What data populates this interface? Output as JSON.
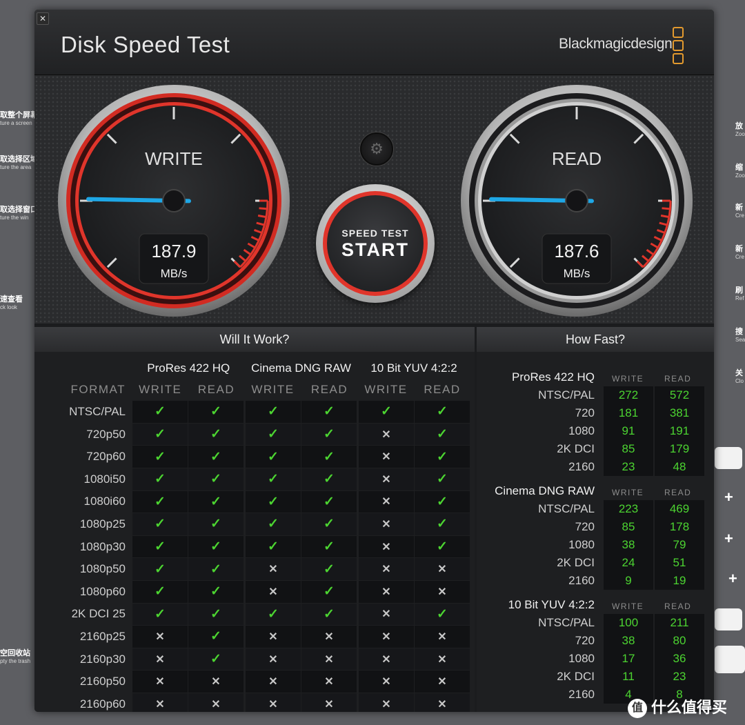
{
  "background": {
    "left_items": [
      {
        "cn": "取整个屏幕",
        "en": "ture a screen"
      },
      {
        "cn": "取选择区域",
        "en": "ture the area"
      },
      {
        "cn": "取选择窗口",
        "en": "ture the win"
      },
      {
        "cn": "速查看",
        "en": "ck look"
      },
      {
        "cn": "空回收站",
        "en": "pty the trash"
      }
    ],
    "right_items": [
      {
        "cn": "放",
        "en": "Zoo"
      },
      {
        "cn": "缩",
        "en": "Zoo"
      },
      {
        "cn": "新",
        "en": "Cre"
      },
      {
        "cn": "新",
        "en": "Cre"
      },
      {
        "cn": "刷",
        "en": "Ref"
      },
      {
        "cn": "搜",
        "en": "Sea"
      },
      {
        "cn": "关",
        "en": "Clo"
      }
    ],
    "plus": "+",
    "watermark": "什么值得买",
    "watermark_icon": "值"
  },
  "app": {
    "title": "Disk Speed Test",
    "brand": "Blackmagicdesign",
    "close_glyph": "✕",
    "gear_glyph": "⚙"
  },
  "gauges": {
    "write": {
      "label": "WRITE",
      "value": "187.9",
      "unit": "MB/s",
      "level": 187.9
    },
    "read": {
      "label": "READ",
      "value": "187.6",
      "unit": "MB/s",
      "level": 187.6
    },
    "start": {
      "top": "SPEED TEST",
      "bottom": "START"
    }
  },
  "will_it_work": {
    "title": "Will It Work?",
    "format_header": "FORMAT",
    "groups": [
      "ProRes 422 HQ",
      "Cinema DNG RAW",
      "10 Bit YUV 4:2:2"
    ],
    "sub_write": "WRITE",
    "sub_read": "READ",
    "rows": [
      {
        "format": "NTSC/PAL",
        "cells": [
          1,
          1,
          1,
          1,
          1,
          1
        ]
      },
      {
        "format": "720p50",
        "cells": [
          1,
          1,
          1,
          1,
          0,
          1
        ]
      },
      {
        "format": "720p60",
        "cells": [
          1,
          1,
          1,
          1,
          0,
          1
        ]
      },
      {
        "format": "1080i50",
        "cells": [
          1,
          1,
          1,
          1,
          0,
          1
        ]
      },
      {
        "format": "1080i60",
        "cells": [
          1,
          1,
          1,
          1,
          0,
          1
        ]
      },
      {
        "format": "1080p25",
        "cells": [
          1,
          1,
          1,
          1,
          0,
          1
        ]
      },
      {
        "format": "1080p30",
        "cells": [
          1,
          1,
          1,
          1,
          0,
          1
        ]
      },
      {
        "format": "1080p50",
        "cells": [
          1,
          1,
          0,
          1,
          0,
          0
        ]
      },
      {
        "format": "1080p60",
        "cells": [
          1,
          1,
          0,
          1,
          0,
          0
        ]
      },
      {
        "format": "2K DCI 25",
        "cells": [
          1,
          1,
          1,
          1,
          0,
          1
        ]
      },
      {
        "format": "2160p25",
        "cells": [
          0,
          1,
          0,
          0,
          0,
          0
        ]
      },
      {
        "format": "2160p30",
        "cells": [
          0,
          1,
          0,
          0,
          0,
          0
        ]
      },
      {
        "format": "2160p50",
        "cells": [
          0,
          0,
          0,
          0,
          0,
          0
        ]
      },
      {
        "format": "2160p60",
        "cells": [
          0,
          0,
          0,
          0,
          0,
          0
        ]
      }
    ]
  },
  "how_fast": {
    "title": "How Fast?",
    "sub_write": "WRITE",
    "sub_read": "READ",
    "groups": [
      {
        "name": "ProRes 422 HQ",
        "rows": [
          {
            "label": "NTSC/PAL",
            "write": "272",
            "read": "572"
          },
          {
            "label": "720",
            "write": "181",
            "read": "381"
          },
          {
            "label": "1080",
            "write": "91",
            "read": "191"
          },
          {
            "label": "2K DCI",
            "write": "85",
            "read": "179"
          },
          {
            "label": "2160",
            "write": "23",
            "read": "48"
          }
        ]
      },
      {
        "name": "Cinema DNG RAW",
        "rows": [
          {
            "label": "NTSC/PAL",
            "write": "223",
            "read": "469"
          },
          {
            "label": "720",
            "write": "85",
            "read": "178"
          },
          {
            "label": "1080",
            "write": "38",
            "read": "79"
          },
          {
            "label": "2K DCI",
            "write": "24",
            "read": "51"
          },
          {
            "label": "2160",
            "write": "9",
            "read": "19"
          }
        ]
      },
      {
        "name": "10 Bit YUV 4:2:2",
        "rows": [
          {
            "label": "NTSC/PAL",
            "write": "100",
            "read": "211"
          },
          {
            "label": "720",
            "write": "38",
            "read": "80"
          },
          {
            "label": "1080",
            "write": "17",
            "read": "36"
          },
          {
            "label": "2K DCI",
            "write": "11",
            "read": "23"
          },
          {
            "label": "2160",
            "write": "4",
            "read": "8"
          }
        ]
      }
    ]
  },
  "colors": {
    "accent_red": "#e0352b",
    "needle_blue": "#1ea7e6",
    "ok_green": "#4cd431",
    "brand_orange": "#e39a2e"
  }
}
